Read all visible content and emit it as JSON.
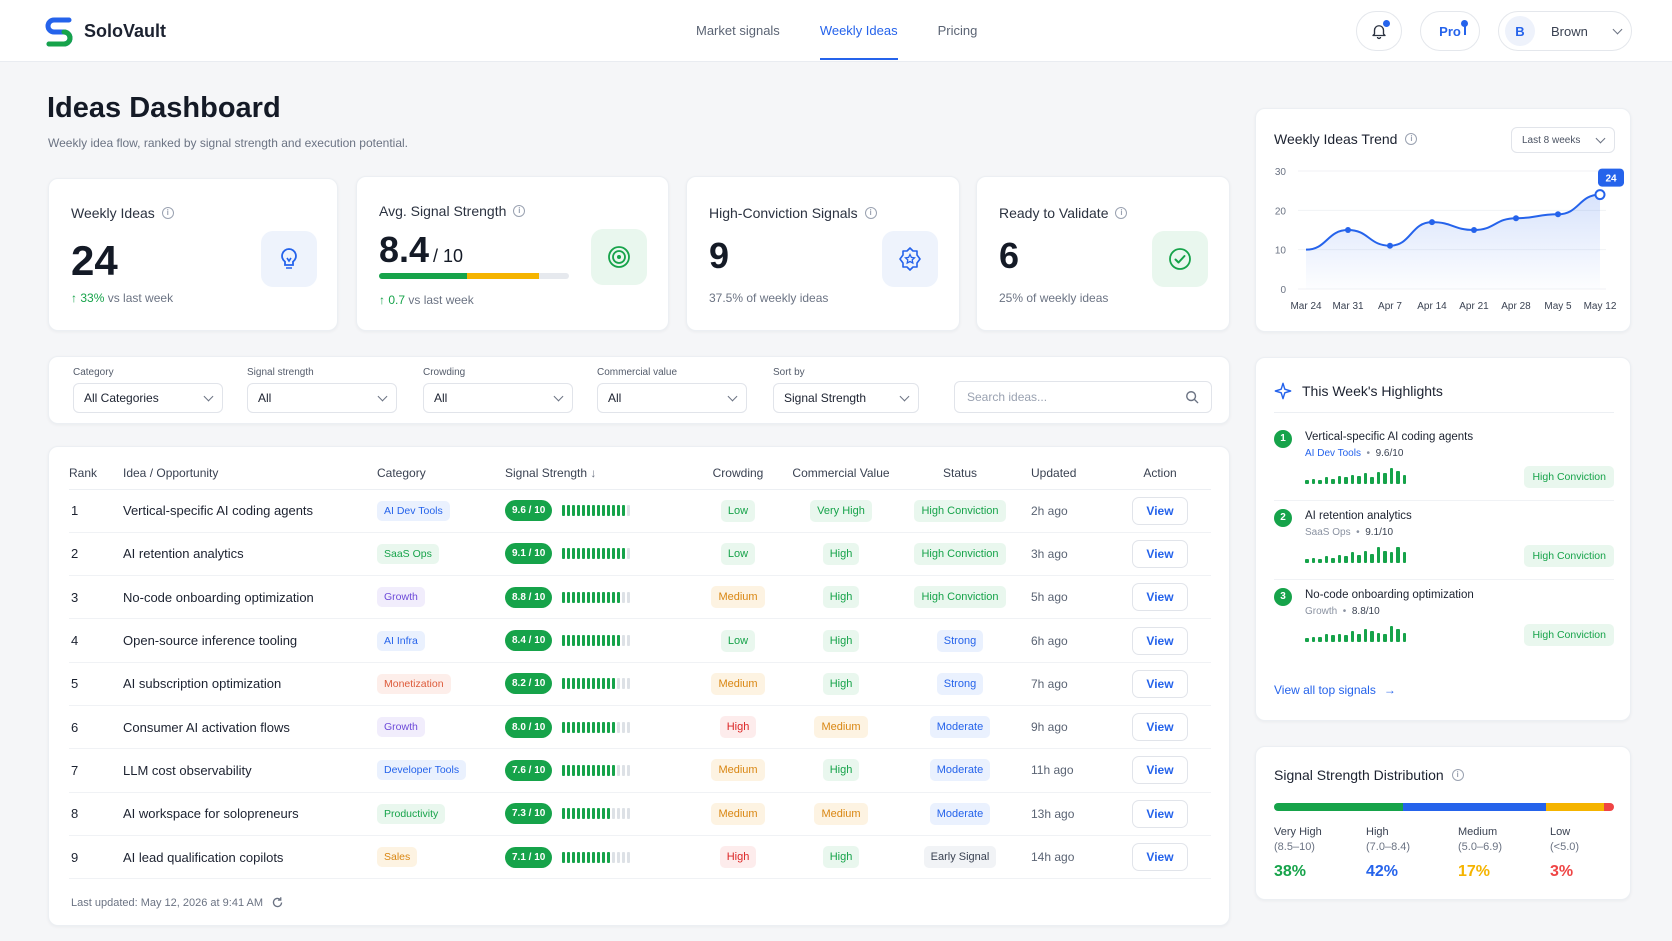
{
  "brand": {
    "name": "SoloVault"
  },
  "nav": {
    "items": [
      "Market signals",
      "Weekly Ideas",
      "Pricing"
    ],
    "active": 1
  },
  "header": {
    "plan": "Pro",
    "user_initial": "B",
    "user_name": "Brown"
  },
  "page": {
    "title": "Ideas Dashboard",
    "subtitle": "Weekly idea flow, ranked by signal strength and execution potential."
  },
  "stats": [
    {
      "label": "Weekly Ideas",
      "value": "24",
      "unit": "",
      "delta": "33%",
      "sub": "vs last week",
      "icon": "lightbulb-icon",
      "color": "#2563eb"
    },
    {
      "label": "Avg. Signal Strength",
      "value": "8.4",
      "unit": "/ 10",
      "delta": "0.7",
      "sub": "vs last week",
      "icon": "target-icon",
      "color": "#16a34a",
      "progress": 0.84
    },
    {
      "label": "High-Conviction Signals",
      "value": "9",
      "unit": "",
      "delta": "",
      "sub": "37.5% of weekly ideas",
      "icon": "badge-star-icon",
      "color": "#2563eb"
    },
    {
      "label": "Ready to Validate",
      "value": "6",
      "unit": "",
      "delta": "",
      "sub": "25% of weekly ideas",
      "icon": "check-circle-icon",
      "color": "#16a34a"
    }
  ],
  "filters": [
    {
      "label": "Category",
      "value": "All Categories"
    },
    {
      "label": "Signal strength",
      "value": "All"
    },
    {
      "label": "Crowding",
      "value": "All"
    },
    {
      "label": "Commercial value",
      "value": "All"
    },
    {
      "label": "Sort by",
      "value": "Signal Strength"
    }
  ],
  "search": {
    "placeholder": "Search ideas..."
  },
  "table": {
    "columns": [
      "Rank",
      "Idea / Opportunity",
      "Category",
      "Signal Strength",
      "Crowding",
      "Commercial Value",
      "Status",
      "Updated",
      "Action"
    ],
    "action_label": "View",
    "rows": [
      {
        "rank": "1",
        "idea": "Vertical-specific AI coding agents",
        "category": "AI Dev Tools",
        "score": "9.6 / 10",
        "level": 0.96,
        "crowding": "Low",
        "value": "Very High",
        "status": "High Conviction",
        "updated": "2h ago"
      },
      {
        "rank": "2",
        "idea": "AI retention analytics",
        "category": "SaaS Ops",
        "score": "9.1 / 10",
        "level": 0.91,
        "crowding": "Low",
        "value": "High",
        "status": "High Conviction",
        "updated": "3h ago"
      },
      {
        "rank": "3",
        "idea": "No-code onboarding optimization",
        "category": "Growth",
        "score": "8.8 / 10",
        "level": 0.88,
        "crowding": "Medium",
        "value": "High",
        "status": "High Conviction",
        "updated": "5h ago"
      },
      {
        "rank": "4",
        "idea": "Open-source inference tooling",
        "category": "AI Infra",
        "score": "8.4 / 10",
        "level": 0.84,
        "crowding": "Low",
        "value": "High",
        "status": "Strong",
        "updated": "6h ago"
      },
      {
        "rank": "5",
        "idea": "AI subscription optimization",
        "category": "Monetization",
        "score": "8.2 / 10",
        "level": 0.82,
        "crowding": "Medium",
        "value": "High",
        "status": "Strong",
        "updated": "7h ago"
      },
      {
        "rank": "6",
        "idea": "Consumer AI activation flows",
        "category": "Growth",
        "score": "8.0 / 10",
        "level": 0.8,
        "crowding": "High",
        "value": "Medium",
        "status": "Moderate",
        "updated": "9h ago"
      },
      {
        "rank": "7",
        "idea": "LLM cost observability",
        "category": "Developer Tools",
        "score": "7.6 / 10",
        "level": 0.76,
        "crowding": "Medium",
        "value": "High",
        "status": "Moderate",
        "updated": "11h ago"
      },
      {
        "rank": "8",
        "idea": "AI workspace for solopreneurs",
        "category": "Productivity",
        "score": "7.3 / 10",
        "level": 0.73,
        "crowding": "Medium",
        "value": "Medium",
        "status": "Moderate",
        "updated": "13h ago"
      },
      {
        "rank": "9",
        "idea": "AI lead qualification copilots",
        "category": "Sales",
        "score": "7.1 / 10",
        "level": 0.71,
        "crowding": "High",
        "value": "High",
        "status": "Early Signal",
        "updated": "14h ago"
      }
    ],
    "footnote": "Last updated: May 12, 2026 at 9:41 AM"
  },
  "trend": {
    "title": "Weekly Ideas Trend",
    "range": "Last 8 weeks",
    "chart_data": {
      "type": "area",
      "x": [
        "Mar 24",
        "Mar 31",
        "Apr 7",
        "Apr 14",
        "Apr 21",
        "Apr 28",
        "May 5",
        "May 12"
      ],
      "values": [
        10,
        15,
        11,
        17,
        15,
        18,
        19,
        24
      ],
      "yticks": [
        "0",
        "10",
        "20",
        "30"
      ],
      "ylim": [
        0,
        30
      ],
      "callout": "24",
      "color": "#2563eb"
    }
  },
  "highlights": {
    "title": "This Week's Highlights",
    "items": [
      {
        "n": "1",
        "name": "Vertical-specific AI coding agents",
        "category": "AI Dev Tools",
        "score": "9.6/10",
        "badge": "High Conviction",
        "spark": [
          3,
          4,
          3,
          5,
          4,
          6,
          5,
          7,
          6,
          8,
          5,
          9,
          8,
          12,
          10,
          7
        ]
      },
      {
        "n": "2",
        "name": "AI retention analytics",
        "category": "SaaS Ops",
        "score": "9.1/10",
        "badge": "High Conviction",
        "spark": [
          3,
          4,
          3,
          5,
          4,
          6,
          5,
          8,
          6,
          9,
          7,
          12,
          9,
          8,
          12,
          8
        ]
      },
      {
        "n": "3",
        "name": "No-code onboarding optimization",
        "category": "Growth",
        "score": "8.8/10",
        "badge": "High Conviction",
        "spark": [
          3,
          4,
          4,
          6,
          5,
          6,
          5,
          8,
          6,
          10,
          8,
          7,
          6,
          12,
          10,
          7
        ]
      }
    ],
    "view_all": "View all top signals"
  },
  "distribution": {
    "title": "Signal Strength Distribution",
    "buckets": [
      {
        "name": "Very High",
        "range": "(8.5–10)",
        "pct": "38%",
        "share": 38,
        "color": "#16a34a"
      },
      {
        "name": "High",
        "range": "(7.0–8.4)",
        "pct": "42%",
        "share": 42,
        "color": "#2563eb"
      },
      {
        "name": "Medium",
        "range": "(5.0–6.9)",
        "pct": "17%",
        "share": 17,
        "color": "#f5b400"
      },
      {
        "name": "Low",
        "range": "(<5.0)",
        "pct": "3%",
        "share": 3,
        "color": "#ef4444"
      }
    ]
  }
}
